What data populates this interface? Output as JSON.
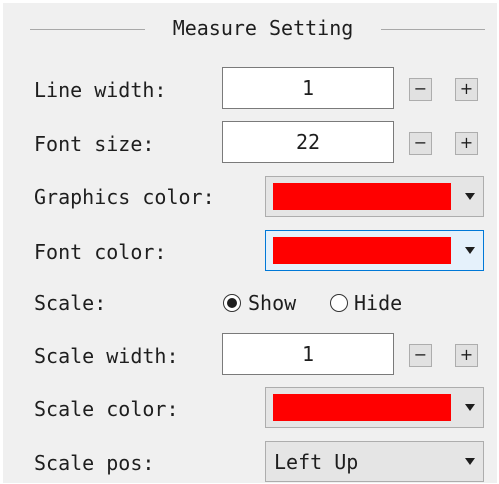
{
  "group": {
    "title": "Measure Setting"
  },
  "line_width": {
    "label": "Line width:",
    "value": "1",
    "decrement": "−",
    "increment": "+"
  },
  "font_size": {
    "label": "Font size:",
    "value": "22",
    "decrement": "−",
    "increment": "+"
  },
  "graphics_color": {
    "label": "Graphics color:",
    "color": "#ff0000"
  },
  "font_color": {
    "label": "Font color:",
    "color": "#ff0000"
  },
  "scale": {
    "label": "Scale:",
    "options": [
      "Show",
      "Hide"
    ],
    "selected": "Show"
  },
  "scale_width": {
    "label": "Scale width:",
    "value": "1",
    "decrement": "−",
    "increment": "+"
  },
  "scale_color": {
    "label": "Scale color:",
    "color": "#ff0000"
  },
  "scale_pos": {
    "label": "Scale pos:",
    "value": "Left Up"
  }
}
